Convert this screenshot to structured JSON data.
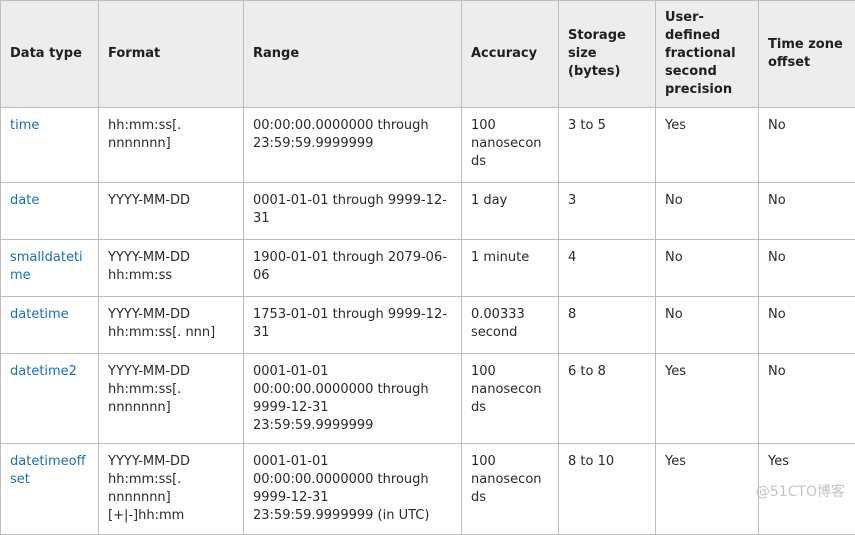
{
  "table": {
    "headers": [
      "Data type",
      "Format",
      "Range",
      "Accuracy",
      "Storage size (bytes)",
      "User-defined fractional second precision",
      "Time zone offset"
    ],
    "rows": [
      {
        "data_type": "time",
        "format": "hh:mm:ss[. nnnnnnn]",
        "range": "00:00:00.0000000 through 23:59:59.9999999",
        "accuracy": "100 nanoseconds",
        "storage_size": "3 to 5",
        "fractional_precision": "Yes",
        "time_zone_offset": "No"
      },
      {
        "data_type": "date",
        "format": "YYYY-MM-DD",
        "range": "0001-01-01 through 9999-12-31",
        "accuracy": "1 day",
        "storage_size": "3",
        "fractional_precision": "No",
        "time_zone_offset": "No"
      },
      {
        "data_type": "smalldatetime",
        "format": "YYYY-MM-DD hh:mm:ss",
        "range": "1900-01-01 through 2079-06-06",
        "accuracy": "1 minute",
        "storage_size": "4",
        "fractional_precision": "No",
        "time_zone_offset": "No"
      },
      {
        "data_type": "datetime",
        "format": "YYYY-MM-DD hh:mm:ss[. nnn]",
        "range": "1753-01-01 through 9999-12-31",
        "accuracy": "0.00333 second",
        "storage_size": "8",
        "fractional_precision": "No",
        "time_zone_offset": "No"
      },
      {
        "data_type": "datetime2",
        "format": "YYYY-MM-DD hh:mm:ss[. nnnnnnn]",
        "range": "0001-01-01 00:00:00.0000000 through 9999-12-31 23:59:59.9999999",
        "accuracy": "100 nanoseconds",
        "storage_size": "6 to 8",
        "fractional_precision": "Yes",
        "time_zone_offset": "No"
      },
      {
        "data_type": "datetimeoffset",
        "format": "YYYY-MM-DD hh:mm:ss[. nnnnnnn] [+|-]hh:mm",
        "range": "0001-01-01 00:00:00.0000000 through 9999-12-31 23:59:59.9999999 (in UTC)",
        "accuracy": "100 nanoseconds",
        "storage_size": "8 to 10",
        "fractional_precision": "Yes",
        "time_zone_offset": "Yes"
      }
    ]
  },
  "watermark": "@51CTO博客",
  "colors": {
    "link": "#1a6fb4",
    "header_bg": "#ededed",
    "border": "#bdbdbd",
    "text": "#2a2a2a"
  }
}
